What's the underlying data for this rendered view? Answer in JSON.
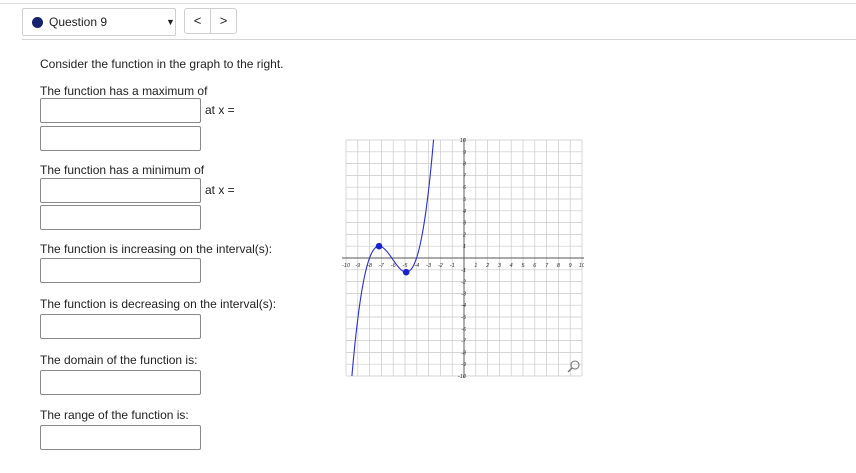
{
  "question_nav": {
    "label": "Question 9",
    "prev": "<",
    "next": ">"
  },
  "prompt": "Consider the function in the graph to the right.",
  "max": {
    "label": "The function has a maximum of",
    "at_label": "at x ="
  },
  "min": {
    "label": "The function has a minimum of",
    "at_label": "at x ="
  },
  "increasing_label": "The function is increasing on the interval(s):",
  "decreasing_label": "The function is decreasing on the interval(s):",
  "domain_label": "The domain of the function is:",
  "range_label": "The range of the function is:",
  "graph": {
    "x_ticks": [
      "-10",
      "-9",
      "-8",
      "-7",
      "-6",
      "-5",
      "-4",
      "-3",
      "-2",
      "-1",
      "1",
      "2",
      "3",
      "4",
      "5",
      "6",
      "7",
      "8",
      "9",
      "10"
    ],
    "y_ticks": [
      "10",
      "9",
      "8",
      "7",
      "6",
      "5",
      "4",
      "3",
      "2",
      "1",
      "-1",
      "-2",
      "-3",
      "-4",
      "-5",
      "-6",
      "-7",
      "-8",
      "-9",
      "-10"
    ],
    "curve_color": "#2a2fd6",
    "point_color": "#1a22c9",
    "points": [
      {
        "x": -7.2,
        "y": 1.0
      },
      {
        "x": -4.9,
        "y": -1.2
      }
    ],
    "zoom_icon": "magnifier-icon"
  },
  "chart_data": {
    "type": "line",
    "xlim": [
      -10,
      10
    ],
    "ylim": [
      -10,
      10
    ],
    "grid": true,
    "key_points": [
      {
        "x": -7.2,
        "y": 1.0
      },
      {
        "x": -4.9,
        "y": -1.2
      }
    ]
  }
}
